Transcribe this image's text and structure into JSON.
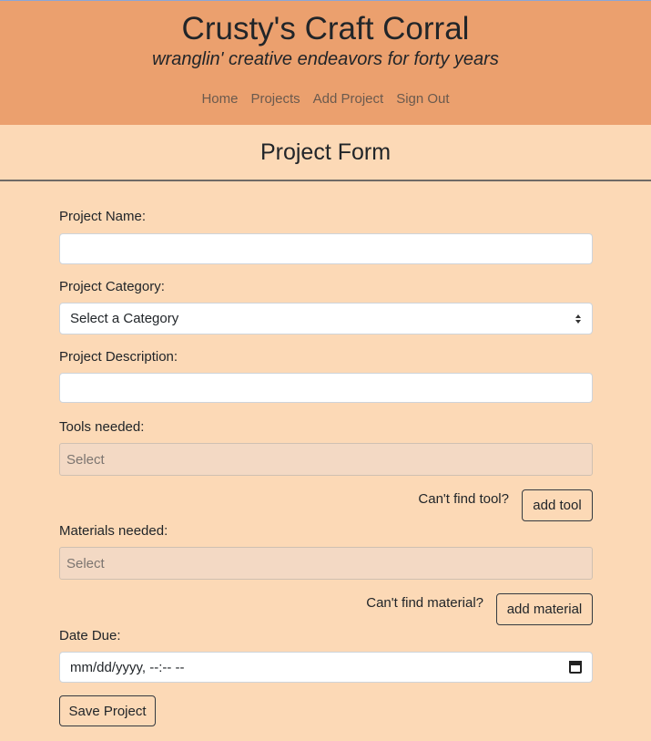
{
  "header": {
    "title": "Crusty's Craft Corral",
    "tagline": "wranglin' creative endeavors for forty years",
    "nav": [
      {
        "label": "Home"
      },
      {
        "label": "Projects"
      },
      {
        "label": "Add Project"
      },
      {
        "label": "Sign Out"
      }
    ]
  },
  "page": {
    "title": "Project Form"
  },
  "form": {
    "name_label": "Project Name:",
    "name_value": "",
    "category_label": "Project Category:",
    "category_selected": "Select a Category",
    "description_label": "Project Description:",
    "description_value": "",
    "tools_label": "Tools needed:",
    "tools_placeholder": "Select",
    "cant_find_tool": "Can't find tool?",
    "add_tool_label": "add tool",
    "materials_label": "Materials needed:",
    "materials_placeholder": "Select",
    "cant_find_material": "Can't find material?",
    "add_material_label": "add material",
    "date_label": "Date Due:",
    "date_placeholder": "mm/dd/yyyy, --:-- --",
    "save_label": "Save Project"
  },
  "colors": {
    "header_bg": "#eba06e",
    "page_bg": "#fcd9b6"
  },
  "icons": {
    "select_arrow": "chevron-up-down-icon",
    "date_picker": "calendar-icon"
  }
}
